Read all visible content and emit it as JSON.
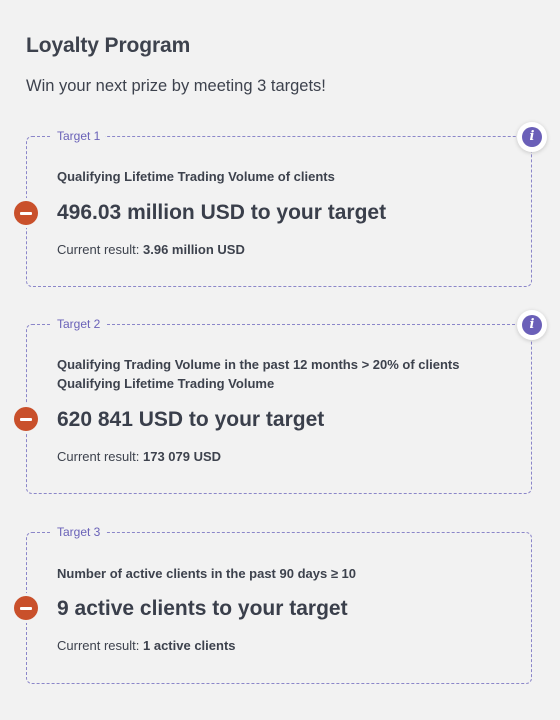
{
  "page": {
    "title": "Loyalty Program",
    "subtitle": "Win your next prize by meeting 3 targets!"
  },
  "targets": [
    {
      "label": "Target 1",
      "has_info": true,
      "criterion": "Qualifying Lifetime Trading Volume of clients",
      "remaining": "496.03 million USD to your target",
      "result_label": "Current result:",
      "result_value": "3.96 million USD",
      "status_icon": "minus-circle-icon"
    },
    {
      "label": "Target 2",
      "has_info": true,
      "criterion": "Qualifying Trading Volume in the past 12 months > 20% of clients Qualifying Lifetime Trading Volume",
      "remaining": "620 841 USD to your target",
      "result_label": "Current result:",
      "result_value": "173 079 USD",
      "status_icon": "minus-circle-icon"
    },
    {
      "label": "Target 3",
      "has_info": false,
      "criterion": "Number of active clients in the past 90 days ≥ 10",
      "remaining": "9 active clients to your target",
      "result_label": "Current result:",
      "result_value": "1 active clients",
      "status_icon": "minus-circle-icon"
    }
  ],
  "icons": {
    "info": "i"
  },
  "colors": {
    "accent": "#6a5fb8",
    "status_unmet": "#c9502b",
    "border": "#8b86c9",
    "background": "#f2f2f2"
  }
}
